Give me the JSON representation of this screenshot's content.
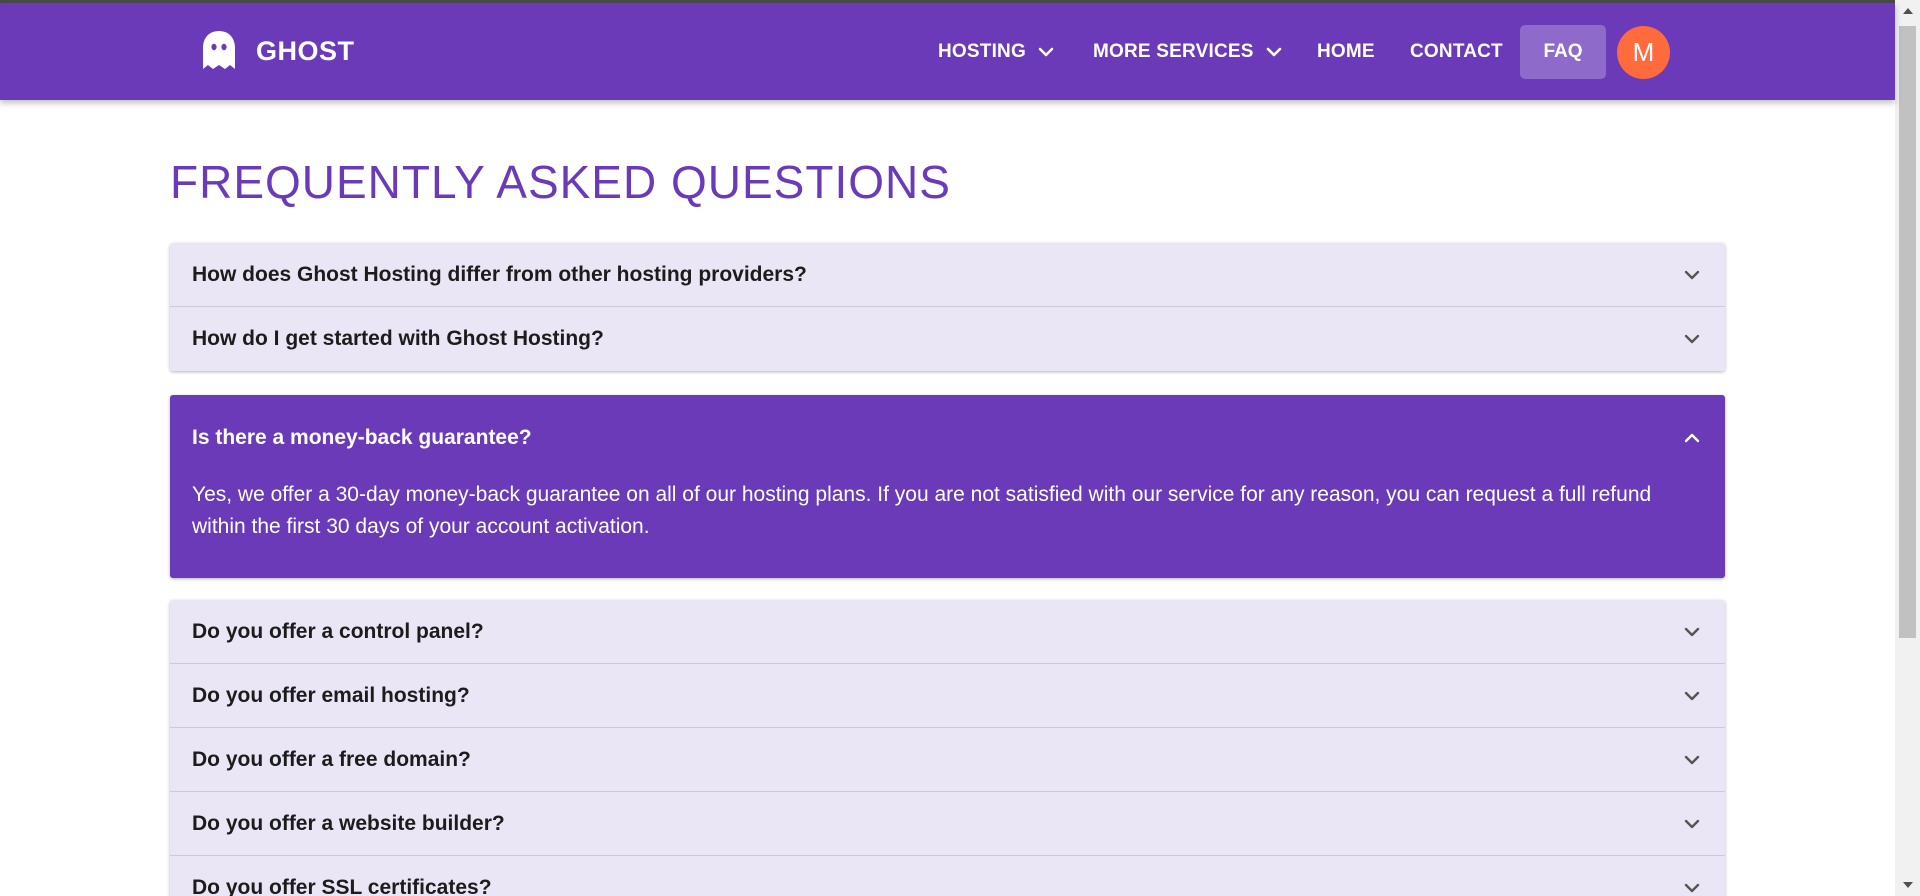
{
  "brand": {
    "name": "GHOST",
    "logo_icon": "ghost-icon"
  },
  "nav": {
    "items": [
      {
        "label": "HOSTING",
        "icon": "chevron-down-icon"
      },
      {
        "label": "MORE SERVICES",
        "icon": "chevron-down-icon"
      },
      {
        "label": "HOME"
      },
      {
        "label": "CONTACT"
      },
      {
        "label": "FAQ",
        "active": true
      }
    ],
    "avatar_initial": "M"
  },
  "page": {
    "title": "FREQUENTLY ASKED QUESTIONS"
  },
  "faq": {
    "items": [
      {
        "question": "How does Ghost Hosting differ from other hosting providers?",
        "expanded": false
      },
      {
        "question": "How do I get started with Ghost Hosting?",
        "expanded": false
      },
      {
        "question": "Is there a money-back guarantee?",
        "expanded": true,
        "answer": "Yes, we offer a 30-day money-back guarantee on all of our hosting plans. If you are not satisfied with our service for any reason, you can request a full refund within the first 30 days of your account activation."
      },
      {
        "question": "Do you offer a control panel?",
        "expanded": false
      },
      {
        "question": "Do you offer email hosting?",
        "expanded": false
      },
      {
        "question": "Do you offer a free domain?",
        "expanded": false
      },
      {
        "question": "Do you offer a website builder?",
        "expanded": false
      },
      {
        "question": "Do you offer SSL certificates?",
        "expanded": false
      }
    ]
  },
  "colors": {
    "primary": "#6a3ab8",
    "faq_active_bg": "#8e6bcb",
    "avatar_bg": "#ff6b3d",
    "accordion_bg": "#ebe6f5"
  }
}
